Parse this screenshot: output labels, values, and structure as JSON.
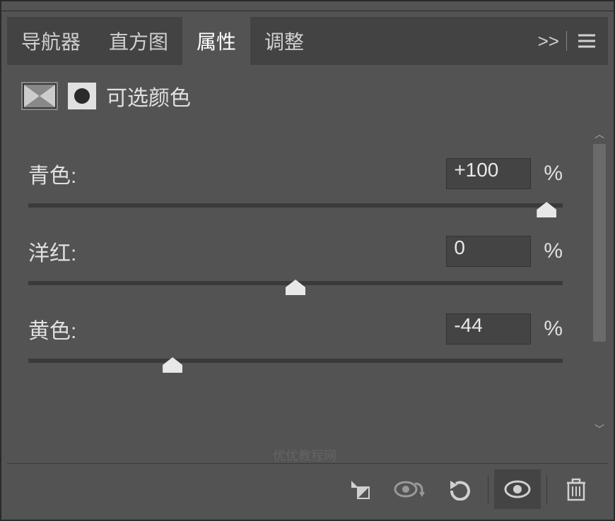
{
  "tabs": {
    "navigator": "导航器",
    "histogram": "直方图",
    "properties": "属性",
    "adjustments": "调整"
  },
  "panel": {
    "title": "可选颜色"
  },
  "sliders": {
    "cyan": {
      "label": "青色:",
      "value": "+100",
      "unit": "%",
      "position": 97
    },
    "magenta": {
      "label": "洋红:",
      "value": "0",
      "unit": "%",
      "position": 50
    },
    "yellow": {
      "label": "黄色:",
      "value": "-44",
      "unit": "%",
      "position": 27
    }
  },
  "icons": {
    "expand": ">>",
    "scrollUp": "︿",
    "scrollDown": "﹀"
  },
  "watermark": "优优教程网"
}
